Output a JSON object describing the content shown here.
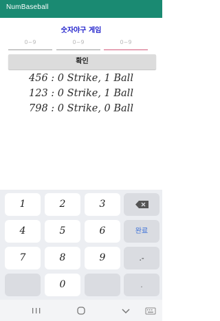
{
  "app": {
    "title": "NumBaseball"
  },
  "game": {
    "title": "숫자야구 게임"
  },
  "inputs": [
    {
      "placeholder": "0~9"
    },
    {
      "placeholder": "0~9"
    },
    {
      "placeholder": "0~9"
    }
  ],
  "confirm": {
    "label": "확인"
  },
  "history": [
    {
      "text": "456  : 0 Strike, 1 Ball"
    },
    {
      "text": "123  : 0 Strike, 1 Ball"
    },
    {
      "text": "798  : 0 Strike, 0 Ball"
    }
  ],
  "keyboard": {
    "keys": [
      "1",
      "2",
      "3",
      "4",
      "5",
      "6",
      "7",
      "8",
      "9",
      "0"
    ],
    "done_label": "완료",
    "punct_label": ".-",
    "dot_label": ".",
    "backspace_icon": "backspace-icon"
  },
  "navbar": {
    "icons": [
      "recents-icon",
      "home-icon",
      "back-icon"
    ]
  },
  "colors": {
    "appbar": "#1a8a72",
    "title": "#2222cc",
    "active_underline": "#d05a7a",
    "done": "#3a6fd8"
  }
}
